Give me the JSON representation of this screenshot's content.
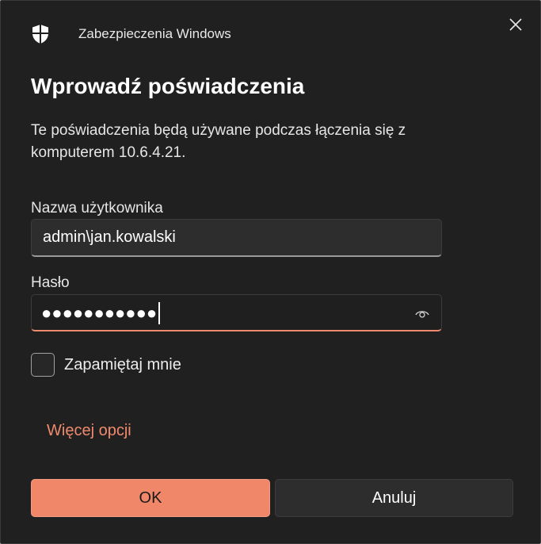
{
  "header": {
    "app_title": "Zabezpieczenia Windows",
    "icon": "shield-icon",
    "close_icon": "close-icon"
  },
  "dialog": {
    "title": "Wprowadź poświadczenia",
    "description": "Te poświadczenia będą używane podczas łączenia się z komputerem 10.6.4.21."
  },
  "username": {
    "label": "Nazwa użytkownika",
    "value": "admin\\jan.kowalski"
  },
  "password": {
    "label": "Hasło",
    "masked_value": "●●●●●●●●●●●",
    "reveal_icon": "eye-icon"
  },
  "remember": {
    "label": "Zapamiętaj mnie",
    "checked": false
  },
  "more_options": "Więcej opcji",
  "buttons": {
    "ok": "OK",
    "cancel": "Anuluj"
  },
  "colors": {
    "accent": "#f08769",
    "background": "#202020",
    "field": "#2d2d2d"
  }
}
